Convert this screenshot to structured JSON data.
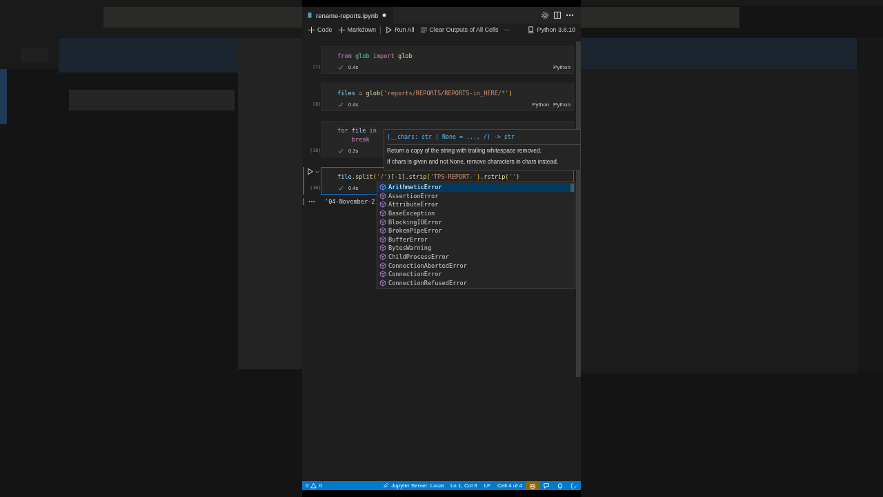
{
  "editor_tab": {
    "title": "rename-reports.ipynb",
    "dirty": true
  },
  "toolbar": {
    "items": [
      {
        "label": "Code",
        "kind": "plus"
      },
      {
        "label": "Markdown",
        "kind": "plus"
      },
      {
        "label": "Run All",
        "kind": "run"
      },
      {
        "label": "Clear Outputs of All Cells",
        "kind": "clear"
      },
      {
        "label": "···",
        "kind": "more"
      }
    ],
    "kernel": "Python 3.8.10"
  },
  "cells": [
    {
      "exec": "[1]",
      "active": false,
      "time": "0.4s",
      "languages": [
        "Python"
      ],
      "lines": [
        [
          {
            "t": "from",
            "kind": "kw"
          },
          {
            "t": " glob",
            "kind": "mod"
          },
          {
            "t": " import",
            "kind": "kw"
          },
          {
            "t": " glob",
            "kind": "fn"
          }
        ]
      ]
    },
    {
      "exec": "[8]",
      "active": false,
      "time": "0.4s",
      "languages": [
        "Python",
        "Python"
      ],
      "lines": [
        [
          {
            "t": "files",
            "kind": "var"
          },
          {
            "t": " = ",
            "kind": "plain"
          },
          {
            "t": "glob",
            "kind": "fn"
          },
          {
            "t": "(",
            "kind": "br"
          },
          {
            "t": "'reports/REPORTS/REPORTS-in_HERE/*'",
            "kind": "str"
          },
          {
            "t": ")",
            "kind": "br"
          }
        ]
      ]
    },
    {
      "exec": "[10]",
      "active": false,
      "time": "0.3s",
      "lines": [
        [
          {
            "t": "for",
            "kind": "kw"
          },
          {
            "t": " file",
            "kind": "var"
          },
          {
            "t": " in",
            "kind": "kw"
          }
        ],
        [
          {
            "t": "    break",
            "kind": "kw"
          }
        ]
      ]
    },
    {
      "exec": "[16]",
      "active": true,
      "time": "0.4s",
      "output": "'04-November-2",
      "lines": [
        [
          {
            "t": "file",
            "kind": "var"
          },
          {
            "t": ".",
            "kind": "plain"
          },
          {
            "t": "split",
            "kind": "fn"
          },
          {
            "t": "(",
            "kind": "br"
          },
          {
            "t": "'/'",
            "kind": "str"
          },
          {
            "t": ")",
            "kind": "br"
          },
          {
            "t": "[-",
            "kind": "plain"
          },
          {
            "t": "1",
            "kind": "num"
          },
          {
            "t": "].",
            "kind": "plain"
          },
          {
            "t": "strip",
            "kind": "fn"
          },
          {
            "t": "(",
            "kind": "br"
          },
          {
            "t": "'TPS-REPORT-'",
            "kind": "str"
          },
          {
            "t": ")",
            "kind": "br"
          },
          {
            "t": ".",
            "kind": "plain"
          },
          {
            "t": "rstrip",
            "kind": "fn"
          },
          {
            "t": "(",
            "kind": "br"
          },
          {
            "t": "''",
            "kind": "str"
          },
          {
            "t": ")",
            "kind": "br"
          }
        ]
      ]
    }
  ],
  "hover": {
    "signature": "(__chars: str | None = ..., /) -> str",
    "doc": [
      "Return a copy of the string with trailing whitespace removed.",
      "If chars is given and not None, remove characters in chars instead."
    ]
  },
  "suggestions": [
    {
      "label": "ArithmeticError",
      "selected": true
    },
    {
      "label": "AssertionError",
      "selected": false
    },
    {
      "label": "AttributeError",
      "selected": false
    },
    {
      "label": "BaseException",
      "selected": false
    },
    {
      "label": "BlockingIOError",
      "selected": false
    },
    {
      "label": "BrokenPipeError",
      "selected": false
    },
    {
      "label": "BufferError",
      "selected": false
    },
    {
      "label": "BytesWarning",
      "selected": false
    },
    {
      "label": "ChildProcessError",
      "selected": false
    },
    {
      "label": "ConnectionAbortedError",
      "selected": false
    },
    {
      "label": "ConnectionError",
      "selected": false
    },
    {
      "label": "ConnectionRefusedError",
      "selected": false
    }
  ],
  "status_bar": {
    "errors": "0",
    "warnings": "0",
    "items": [
      "Jupyter Server: Local",
      "Ln 1, Col 9",
      "LF",
      "Cell 4 of 4"
    ]
  }
}
